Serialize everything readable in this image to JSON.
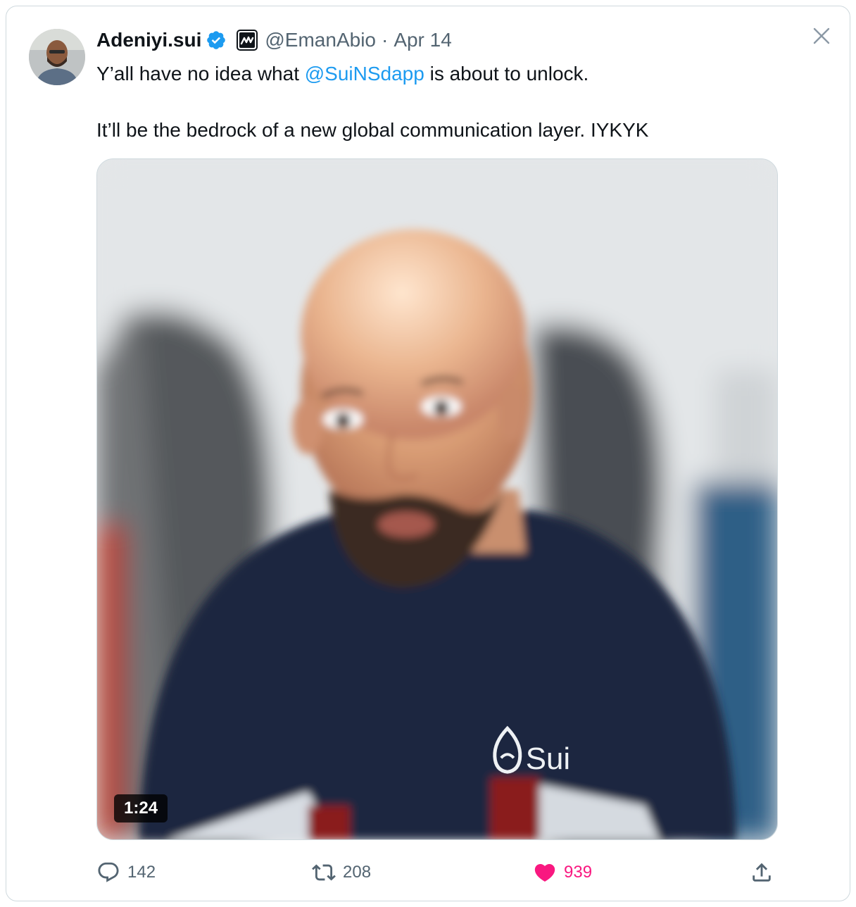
{
  "tweet": {
    "author": {
      "display_name": "Adeniyi.sui",
      "handle": "@EmanAbio",
      "separator": "·",
      "date": "Apr 14",
      "verified": true,
      "avatar_icon": "person-avatar"
    },
    "text": {
      "line1_before": "Y’all have no idea what ",
      "mention": "@SuiNSdapp",
      "line1_after": " is about to unlock.",
      "line2": "It’ll be the bedrock of a new global communication layer. IYKYK"
    },
    "media": {
      "type": "video",
      "duration": "1:24",
      "shirt_logo_text": "Sui"
    },
    "stats": {
      "replies": "142",
      "reposts": "208",
      "likes": "939"
    }
  },
  "colors": {
    "text": "#0f1419",
    "muted": "#536471",
    "link": "#1d9bf0",
    "verified": "#1d9bf0",
    "like": "#f91880",
    "border": "#cfd9de"
  },
  "icons": [
    "close-icon",
    "verified-badge-icon",
    "affiliate-badge-icon",
    "reply-icon",
    "repost-icon",
    "like-icon",
    "share-icon"
  ]
}
